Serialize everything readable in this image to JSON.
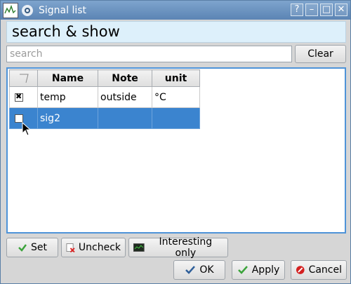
{
  "window": {
    "title": "Signal list",
    "controls": [
      "?",
      "–",
      "□",
      "✕"
    ]
  },
  "header": {
    "title": "search & show"
  },
  "search": {
    "placeholder": "search",
    "value": "",
    "clear_label": "Clear"
  },
  "table": {
    "columns": [
      "",
      "Name",
      "Note",
      "unit"
    ],
    "rows": [
      {
        "checked": true,
        "name": "temp",
        "note": "outside",
        "unit": "°C",
        "selected": false
      },
      {
        "checked": false,
        "name": "sig2",
        "note": "",
        "unit": "",
        "selected": true
      }
    ]
  },
  "actions": {
    "set_label": "Set",
    "uncheck_label": "Uncheck",
    "interesting_label": "Interesting only"
  },
  "dialog": {
    "ok_label": "OK",
    "apply_label": "Apply",
    "cancel_label": "Cancel"
  },
  "colors": {
    "titlebar": "#6a93c2",
    "selection": "#3b84cf",
    "header_bg": "#ddf0fb",
    "table_border": "#4e93d8"
  }
}
